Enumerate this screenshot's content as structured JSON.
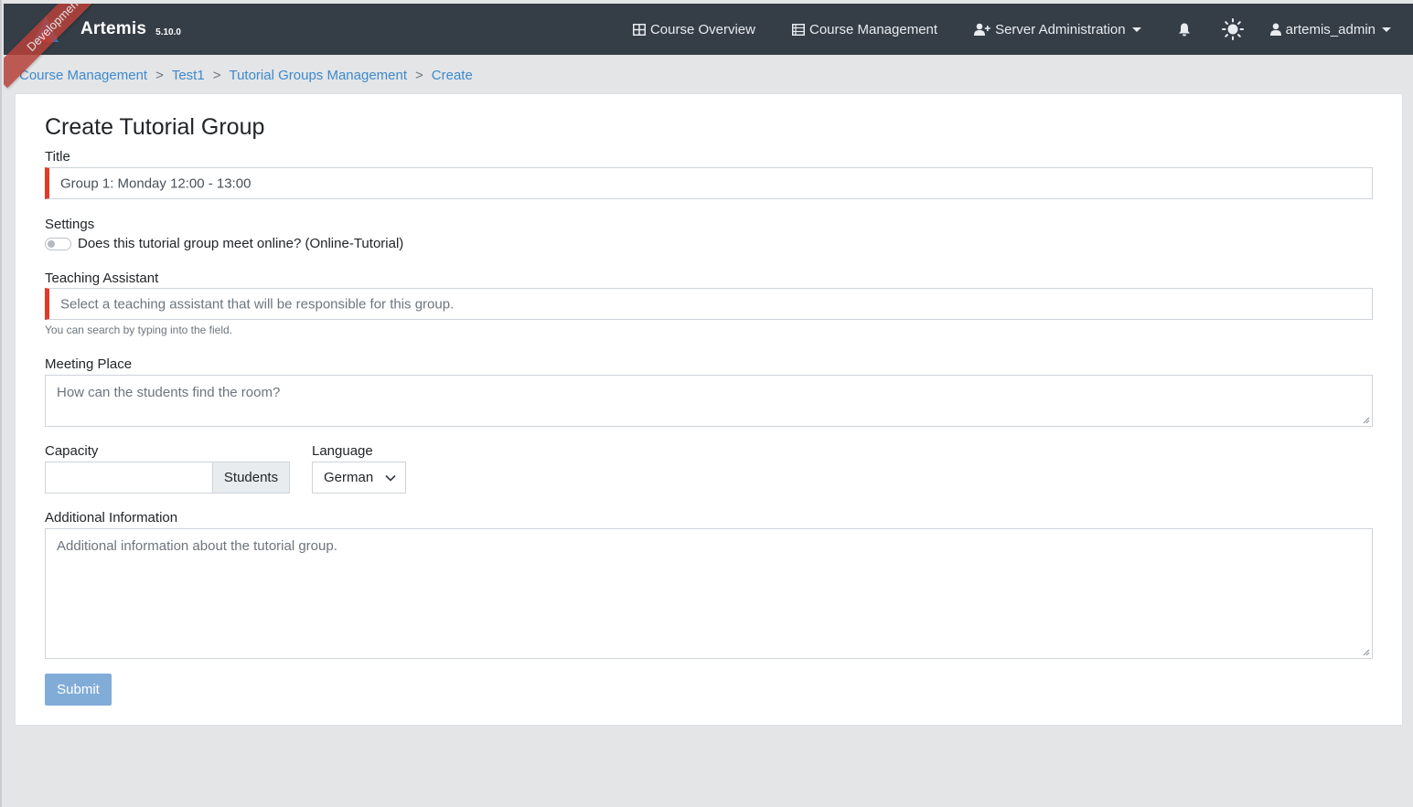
{
  "app": {
    "name": "Artemis",
    "version": "5.10.0",
    "ribbon": "Development"
  },
  "nav": {
    "course_overview": "Course Overview",
    "course_management": "Course Management",
    "server_administration": "Server Administration",
    "user": "artemis_admin",
    "icons": [
      "table-icon",
      "list-icon",
      "user-plus-icon",
      "bell-icon",
      "sun-icon",
      "user-icon"
    ]
  },
  "breadcrumb": [
    "Course Management",
    "Test1",
    "Tutorial Groups Management",
    "Create"
  ],
  "form": {
    "heading": "Create Tutorial Group",
    "title_label": "Title",
    "title_value": "Group 1: Monday 12:00 - 13:00",
    "settings_label": "Settings",
    "online_toggle_label": "Does this tutorial group meet online? (Online-Tutorial)",
    "online": false,
    "ta_label": "Teaching Assistant",
    "ta_placeholder": "Select a teaching assistant that will be responsible for this group.",
    "ta_hint": "You can search by typing into the field.",
    "meeting_label": "Meeting Place",
    "meeting_placeholder": "How can the students find the room?",
    "capacity_label": "Capacity",
    "capacity_value": "",
    "capacity_unit": "Students",
    "language_label": "Language",
    "language_value": "German",
    "additional_label": "Additional Information",
    "additional_placeholder": "Additional information about the tutorial group.",
    "submit_label": "Submit"
  },
  "colors": {
    "navbar": "#353d47",
    "link": "#3e8acc",
    "invalid": "#e23a2a",
    "submit": "#82acd8",
    "ribbon": "#b7413a"
  }
}
